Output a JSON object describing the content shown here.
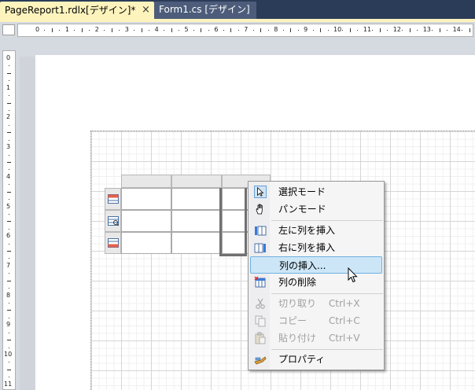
{
  "tabs": [
    {
      "label": "PageReport1.rdlx[デザイン]*",
      "active": true,
      "close": "×"
    },
    {
      "label": "Form1.cs [デザイン]",
      "active": false
    }
  ],
  "ruler": {
    "h_labels": [
      "0",
      "1",
      "2",
      "3",
      "4",
      "5",
      "6",
      "7",
      "8",
      "9",
      "10",
      "11",
      "12",
      "13",
      "14"
    ],
    "v_labels": [
      "0",
      "1",
      "2",
      "3",
      "4",
      "5",
      "6",
      "7",
      "8",
      "9",
      "10",
      "11"
    ]
  },
  "menu": {
    "items": [
      {
        "id": "select-mode",
        "label": "選択モード",
        "icon": "pointer-icon",
        "shortcut": "",
        "enabled": true
      },
      {
        "id": "pan-mode",
        "label": "パンモード",
        "icon": "hand-icon",
        "shortcut": "",
        "enabled": true
      },
      {
        "id": "insert-column-left",
        "label": "左に列を挿入",
        "icon": "insert-column-left-icon",
        "shortcut": "",
        "enabled": true
      },
      {
        "id": "insert-column-right",
        "label": "右に列を挿入",
        "icon": "insert-column-right-icon",
        "shortcut": "",
        "enabled": true
      },
      {
        "id": "insert-column",
        "label": "列の挿入...",
        "icon": "",
        "shortcut": "",
        "enabled": true,
        "highlighted": true
      },
      {
        "id": "delete-column",
        "label": "列の削除",
        "icon": "delete-column-icon",
        "shortcut": "",
        "enabled": true
      },
      {
        "id": "cut",
        "label": "切り取り",
        "icon": "scissors-icon",
        "shortcut": "Ctrl+X",
        "enabled": false
      },
      {
        "id": "copy",
        "label": "コピー",
        "icon": "copy-icon",
        "shortcut": "Ctrl+C",
        "enabled": false
      },
      {
        "id": "paste",
        "label": "貼り付け",
        "icon": "paste-icon",
        "shortcut": "Ctrl+V",
        "enabled": false
      },
      {
        "id": "properties",
        "label": "プロパティ",
        "icon": "properties-icon",
        "shortcut": "",
        "enabled": true
      }
    ]
  },
  "colors": {
    "active_tab": "#fdf3bd",
    "highlight": "#cde6f7",
    "chrome": "#2b3c59"
  }
}
